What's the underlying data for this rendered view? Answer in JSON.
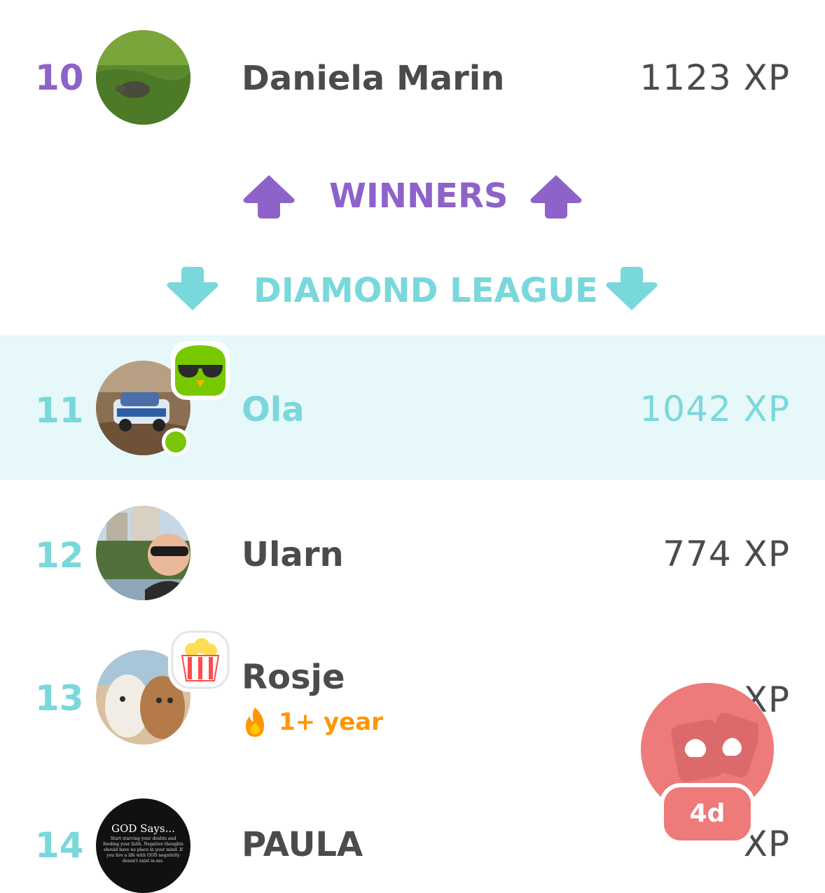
{
  "colors": {
    "promotion": "#8d63ca",
    "demotion": "#79d8db",
    "text": "#4b4b4b",
    "highlight_bg": "#e6f8f9",
    "streak": "#ff9600",
    "fab": "#ee7a7a"
  },
  "rows": [
    {
      "rank": "10",
      "name": "Daniela Marin",
      "xp": "1123 XP"
    },
    {
      "rank": "11",
      "name": "Ola",
      "xp": "1042 XP",
      "online": true,
      "badge": "sunglasses-owl-icon"
    },
    {
      "rank": "12",
      "name": "Ularn",
      "xp": "774 XP"
    },
    {
      "rank": "13",
      "name": "Rosje",
      "xp": "XP",
      "streak": "1+ year",
      "badge": "popcorn-icon"
    },
    {
      "rank": "14",
      "name": "PAULA",
      "xp": "XP"
    }
  ],
  "zones": {
    "promotion_label": "WINNERS",
    "demotion_label": "DIAMOND LEAGUE"
  },
  "avatars": {
    "row14_text_title": "GOD Says...",
    "row14_text_body": "Start starving your doubts and feeding your faith. Negative thoughts should have no place in your mind. If you live a life with GOD negativity doesn't exist in me."
  },
  "fab": {
    "icon": "friends-quest-icon",
    "timer": "4d"
  }
}
